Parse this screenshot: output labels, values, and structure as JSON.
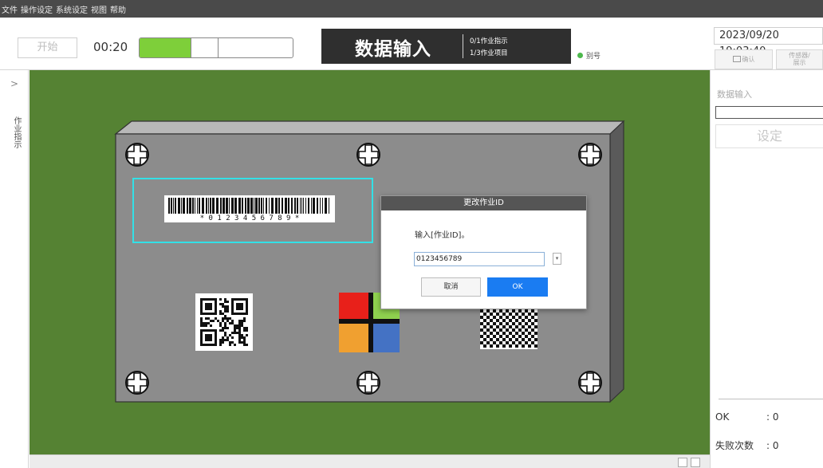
{
  "menu": [
    "文件",
    "操作设定",
    "系统设定",
    "视图",
    "帮助"
  ],
  "header": {
    "start_label": "开始",
    "timer": "00:20",
    "progress": 0.34,
    "progress_segments": 3,
    "title": "数据输入",
    "sub1": "0/1作业指示",
    "sub2": "1/3作业项目",
    "alias_label": "别号",
    "alias_color": "#4cb84c",
    "datetime": "2023/09/20 19:03:40",
    "btn1_label": "确认",
    "btn2_line1": "传感器/",
    "btn2_line2": "展示"
  },
  "left_panel": {
    "toggle_icon": "chevron-right-icon",
    "toggle_glyph": ">",
    "vertical_label": "作业指示"
  },
  "canvas": {
    "background": "#558233",
    "barcode_text": "* 0 1 2 3 4 5 6 7 8 9 *",
    "highlight_color": "#33e0e6",
    "plate_color": "#8c8c8c"
  },
  "dialog": {
    "title": "更改作业ID",
    "message": "输入[作业ID]。",
    "input_value": "0123456789",
    "cancel_label": "取消",
    "ok_label": "OK",
    "ok_color": "#1a7cf2"
  },
  "right_panel": {
    "input_label": "数据输入",
    "set_label": "设定",
    "ok_label": "OK",
    "ok_value": ": 0",
    "fail_label": "失败次数",
    "fail_value": ": 0"
  }
}
